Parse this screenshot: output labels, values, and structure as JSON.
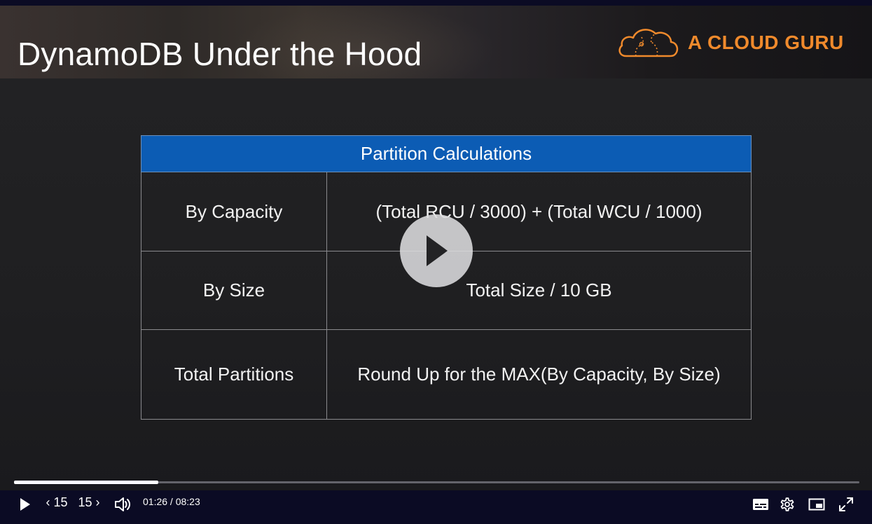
{
  "slide": {
    "title": "DynamoDB Under the Hood",
    "brand": "A CLOUD GURU"
  },
  "table": {
    "header": "Partition Calculations",
    "rows": [
      {
        "label": "By Capacity",
        "formula": "(Total RCU / 3000) + (Total WCU / 1000)"
      },
      {
        "label": "By Size",
        "formula": "Total Size / 10 GB"
      },
      {
        "label": "Total Partitions",
        "formula": "Round Up for the MAX(By Capacity, By Size)"
      }
    ]
  },
  "player": {
    "current_time": "01:26",
    "duration": "08:23",
    "time_display": "01:26 / 08:23",
    "progress_fraction": 0.171,
    "skip_back_label": "‹ 15",
    "skip_forward_label": "15 ›",
    "icons": {
      "overlay_play": "play-icon",
      "play": "play-icon",
      "volume": "volume-icon",
      "captions": "captions-icon",
      "settings": "gear-icon",
      "pip": "picture-in-picture-icon",
      "fullscreen": "fullscreen-icon"
    }
  },
  "colors": {
    "table_header_bg": "#0c5cb4",
    "brand": "#f08a2c",
    "controls_bg": "#0b0b24"
  }
}
